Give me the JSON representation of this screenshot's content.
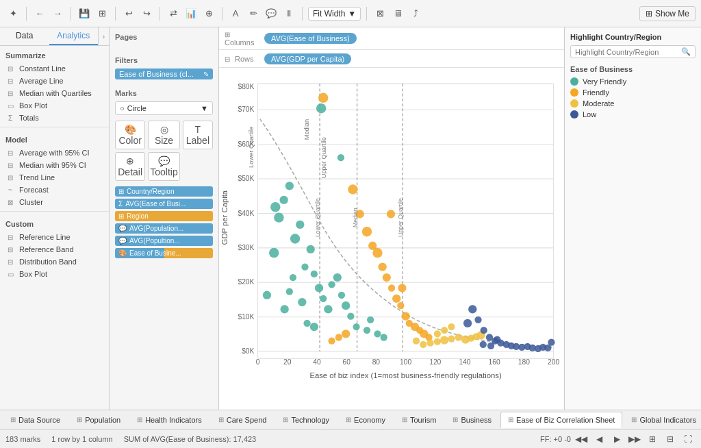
{
  "toolbar": {
    "show_me": "Show Me",
    "fit_width": "Fit Width"
  },
  "left_panel": {
    "tabs": [
      "Data",
      "Analytics"
    ],
    "summarize_title": "Summarize",
    "summarize_items": [
      "Constant Line",
      "Average Line",
      "Median with Quartiles",
      "Box Plot",
      "Totals"
    ],
    "model_title": "Model",
    "model_items": [
      "Average with 95% CI",
      "Median with 95% CI",
      "Trend Line",
      "Forecast",
      "Cluster"
    ],
    "custom_title": "Custom",
    "custom_items": [
      "Reference Line",
      "Reference Band",
      "Distribution Band",
      "Box Plot"
    ]
  },
  "filters": {
    "title": "Filters",
    "items": [
      "Ease of Business (cl..."
    ]
  },
  "marks": {
    "title": "Marks",
    "type": "Circle",
    "buttons": [
      "Color",
      "Size",
      "Label",
      "Detail",
      "Tooltip"
    ],
    "fields": [
      {
        "label": "Country/Region",
        "color": "teal"
      },
      {
        "label": "AVG(Ease of Busi...",
        "color": "teal"
      },
      {
        "label": "Region",
        "color": "orange"
      },
      {
        "label": "AVG(Population...",
        "color": "teal"
      },
      {
        "label": "AVG(Popultion...",
        "color": "teal"
      },
      {
        "label": "Ease of Busine...",
        "color": "multi"
      }
    ]
  },
  "shelves": {
    "columns_label": "Columns",
    "rows_label": "Rows",
    "columns_field": "AVG(Ease of Business)",
    "rows_field": "AVG(GDP per Capita)"
  },
  "chart": {
    "x_title": "Ease of biz index (1=most business-friendly regulations)",
    "y_title": "GDP per Capita",
    "x_ticks": [
      "0",
      "20",
      "40",
      "60",
      "80",
      "100",
      "120",
      "140",
      "160",
      "180",
      "200"
    ],
    "y_ticks": [
      "$0K",
      "$10K",
      "$20K",
      "$30K",
      "$40K",
      "$50K",
      "$60K",
      "$70K",
      "$80K"
    ],
    "ref_lines": [
      "Lower Quartile",
      "Median",
      "Upper Quartile"
    ],
    "pages_label": "Pages"
  },
  "right_panel": {
    "highlight_title": "Highlight Country/Region",
    "search_placeholder": "Highlight Country/Region",
    "legend_title": "Ease of Business",
    "legend_items": [
      {
        "label": "Very Friendly",
        "color": "#4aaf9e"
      },
      {
        "label": "Friendly",
        "color": "#f5a623"
      },
      {
        "label": "Moderate",
        "color": "#f0c040"
      },
      {
        "label": "Low",
        "color": "#3b5998"
      }
    ]
  },
  "bottom_tabs": [
    {
      "label": "Data Source",
      "icon": "⊞",
      "active": false
    },
    {
      "label": "Population",
      "icon": "⊞",
      "active": false
    },
    {
      "label": "Health Indicators",
      "icon": "⊞",
      "active": false
    },
    {
      "label": "Care Spend",
      "icon": "⊞",
      "active": false
    },
    {
      "label": "Technology",
      "icon": "⊞",
      "active": false
    },
    {
      "label": "Economy",
      "icon": "⊞",
      "active": false
    },
    {
      "label": "Tourism",
      "icon": "⊞",
      "active": false
    },
    {
      "label": "Business",
      "icon": "⊞",
      "active": false
    },
    {
      "label": "Ease of Biz Correlation Sheet",
      "icon": "⊞",
      "active": true
    },
    {
      "label": "Global Indicators",
      "icon": "⊞",
      "active": false
    }
  ],
  "status_bar": {
    "marks": "183 marks",
    "rows": "1 row by 1 column",
    "sum": "SUM of AVG(Ease of Business): 17,423",
    "ff": "FF: +0 -0"
  }
}
